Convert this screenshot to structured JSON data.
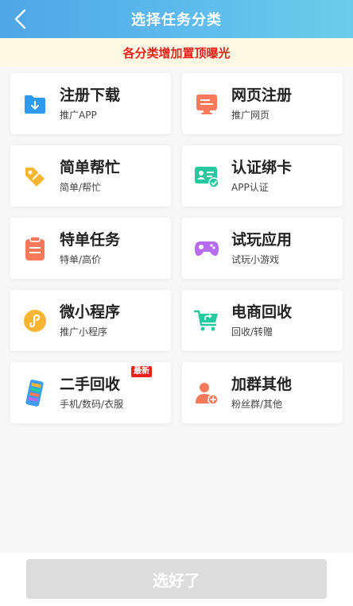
{
  "header": {
    "title": "选择任务分类",
    "back_icon": "chevron-left-icon"
  },
  "notice": {
    "text": "各分类增加置顶曝光"
  },
  "categories": [
    {
      "title": "注册下载",
      "subtitle": "推广APP",
      "icon": "folder-download-icon",
      "color": "#2f9bf0"
    },
    {
      "title": "网页注册",
      "subtitle": "推广网页",
      "icon": "webpage-icon",
      "color": "#f5795a"
    },
    {
      "title": "简单帮忙",
      "subtitle": "简单/帮忙",
      "icon": "tag-icon",
      "color": "#f7b531"
    },
    {
      "title": "认证绑卡",
      "subtitle": "APP认证",
      "icon": "id-card-check-icon",
      "color": "#25c9a0"
    },
    {
      "title": "特单任务",
      "subtitle": "特单/高价",
      "icon": "clipboard-icon",
      "color": "#f5795a"
    },
    {
      "title": "试玩应用",
      "subtitle": "试玩小游戏",
      "icon": "gamepad-icon",
      "color": "#b76cf0"
    },
    {
      "title": "微小程序",
      "subtitle": "推广小程序",
      "icon": "mini-program-icon",
      "color": "#f7b531"
    },
    {
      "title": "电商回收",
      "subtitle": "回收/转赠",
      "icon": "shopping-cart-icon",
      "color": "#25c9a0"
    },
    {
      "title": "二手回收",
      "subtitle": "手机/数码/衣服",
      "icon": "phone-icon",
      "color": "#3d9cf2",
      "badge": "最新"
    },
    {
      "title": "加群其他",
      "subtitle": "粉丝群/其他",
      "icon": "user-add-icon",
      "color": "#f5795a"
    }
  ],
  "footer": {
    "confirm_label": "选好了"
  }
}
